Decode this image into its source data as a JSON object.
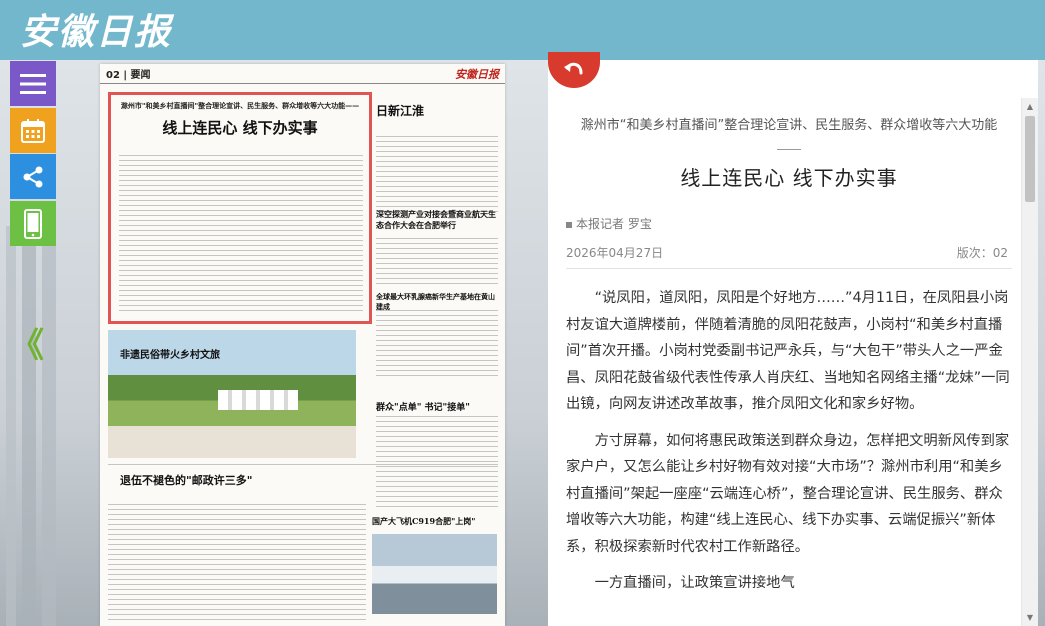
{
  "brand": {
    "name": "安徽日报"
  },
  "sidebar": {
    "buttons": [
      {
        "icon": "menu-icon",
        "color": "#7b58c8"
      },
      {
        "icon": "calendar-icon",
        "color": "#f0a21e"
      },
      {
        "icon": "share-icon",
        "color": "#2d8fe0"
      },
      {
        "icon": "mobile-icon",
        "color": "#6cc043"
      }
    ],
    "back": "《"
  },
  "paper": {
    "page_label": "02 | 要闻",
    "logo": "安徽日报",
    "main_article": {
      "kicker": "滁州市\"和美乡村直播间\"整合理论宣讲、民生服务、群众增收等六大功能——",
      "headline": "线上连民心 线下办实事"
    },
    "headlines": [
      "日新江淮",
      "深空探测产业对接会暨商业航天生态合作大会在合肥举行",
      "全球最大环乳腺癌新华生产基地在黄山建成",
      "非遗民俗带火乡村文旅",
      "退伍不褪色的\"邮政许三多\"",
      "群众\"点单\" 书记\"接单\"",
      "国产大飞机C919合肥\"上岗\""
    ]
  },
  "reader": {
    "subtitle": "滁州市“和美乡村直播间”整合理论宣讲、民生服务、群众增收等六大功能",
    "title": "线上连民心 线下办实事",
    "author": "本报记者 罗宝",
    "date": "2026年04月27日",
    "edition": "版次：02",
    "paragraphs": [
      "“说凤阳，道凤阳，凤阳是个好地方……”4月11日，在凤阳县小岗村友谊大道牌楼前，伴随着清脆的凤阳花鼓声，小岗村“和美乡村直播间”首次开播。小岗村党委副书记严永兵，与“大包干”带头人之一严金昌、凤阳花鼓省级代表性传承人肖庆红、当地知名网络主播“龙妹”一同出镜，向网友讲述改革故事，推介凤阳文化和家乡好物。",
      "方寸屏幕，如何将惠民政策送到群众身边，怎样把文明新风传到家家户户，又怎么能让乡村好物有效对接“大市场”？滁州市利用“和美乡村直播间”架起一座座“云端连心桥”，整合理论宣讲、民生服务、群众增收等六大功能，构建“线上连民心、线下办实事、云端促振兴”新体系，积极探索新时代农村工作新路径。",
      "一方直播间，让政策宣讲接地气"
    ]
  }
}
